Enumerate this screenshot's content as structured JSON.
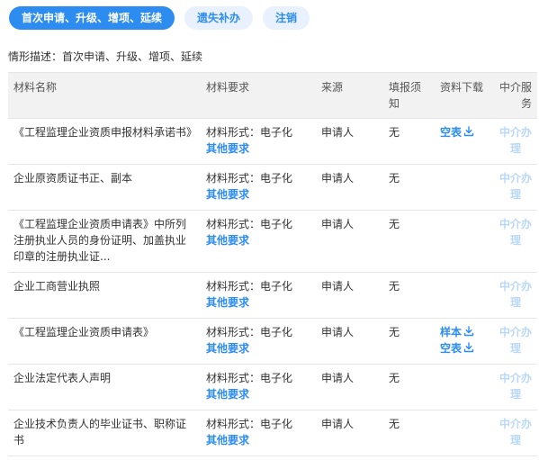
{
  "tabs": [
    {
      "label": "首次申请、升级、增项、延续",
      "active": true
    },
    {
      "label": "遗失补办",
      "active": false
    },
    {
      "label": "注销",
      "active": false
    }
  ],
  "description": {
    "text": "情形描述：首次申请、升级、增项、延续"
  },
  "table": {
    "headers": [
      "材料名称",
      "材料要求",
      "来源",
      "填报须知",
      "资料下载",
      "中介服务"
    ],
    "rows": [
      {
        "name": "《工程监理企业资质申报材料承诺书》",
        "form": "材料形式：电子化",
        "other": "其他要求",
        "source": "申请人",
        "notice": "无",
        "downloads": [
          "空表"
        ],
        "service": "中介办理"
      },
      {
        "name": "企业原资质证书正、副本",
        "form": "材料形式：电子化",
        "other": "其他要求",
        "source": "申请人",
        "notice": "无",
        "downloads": [],
        "service": "中介办理"
      },
      {
        "name": "《工程监理企业资质申请表》中所列注册执业人员的身份证明、加盖执业印章的注册执业证...",
        "form": "材料形式：电子化",
        "other": "其他要求",
        "source": "申请人",
        "notice": "无",
        "downloads": [],
        "service": "中介办理"
      },
      {
        "name": "企业工商营业执照",
        "form": "材料形式：电子化",
        "other": "其他要求",
        "source": "申请人",
        "notice": "无",
        "downloads": [],
        "service": "中介办理"
      },
      {
        "name": "《工程监理企业资质申请表》",
        "form": "材料形式：电子化",
        "other": "其他要求",
        "source": "申请人",
        "notice": "无",
        "downloads": [
          "样本",
          "空表"
        ],
        "service": "中介办理"
      },
      {
        "name": "企业法定代表人声明",
        "form": "材料形式：电子化",
        "other": "其他要求",
        "source": "申请人",
        "notice": "无",
        "downloads": [],
        "service": "中介办理"
      },
      {
        "name": "企业技术负责人的毕业证书、职称证书",
        "form": "材料形式：电子化",
        "other": "其他要求",
        "source": "申请人",
        "notice": "无",
        "downloads": [],
        "service": "中介办理"
      }
    ]
  },
  "colors": {
    "accent": "#2d8cf0",
    "tab_inactive_bg": "#e8f1fd",
    "service_disabled": "#b9d8f8",
    "header_bg": "#f2f2f2"
  },
  "icons": {
    "download": "download-icon"
  }
}
